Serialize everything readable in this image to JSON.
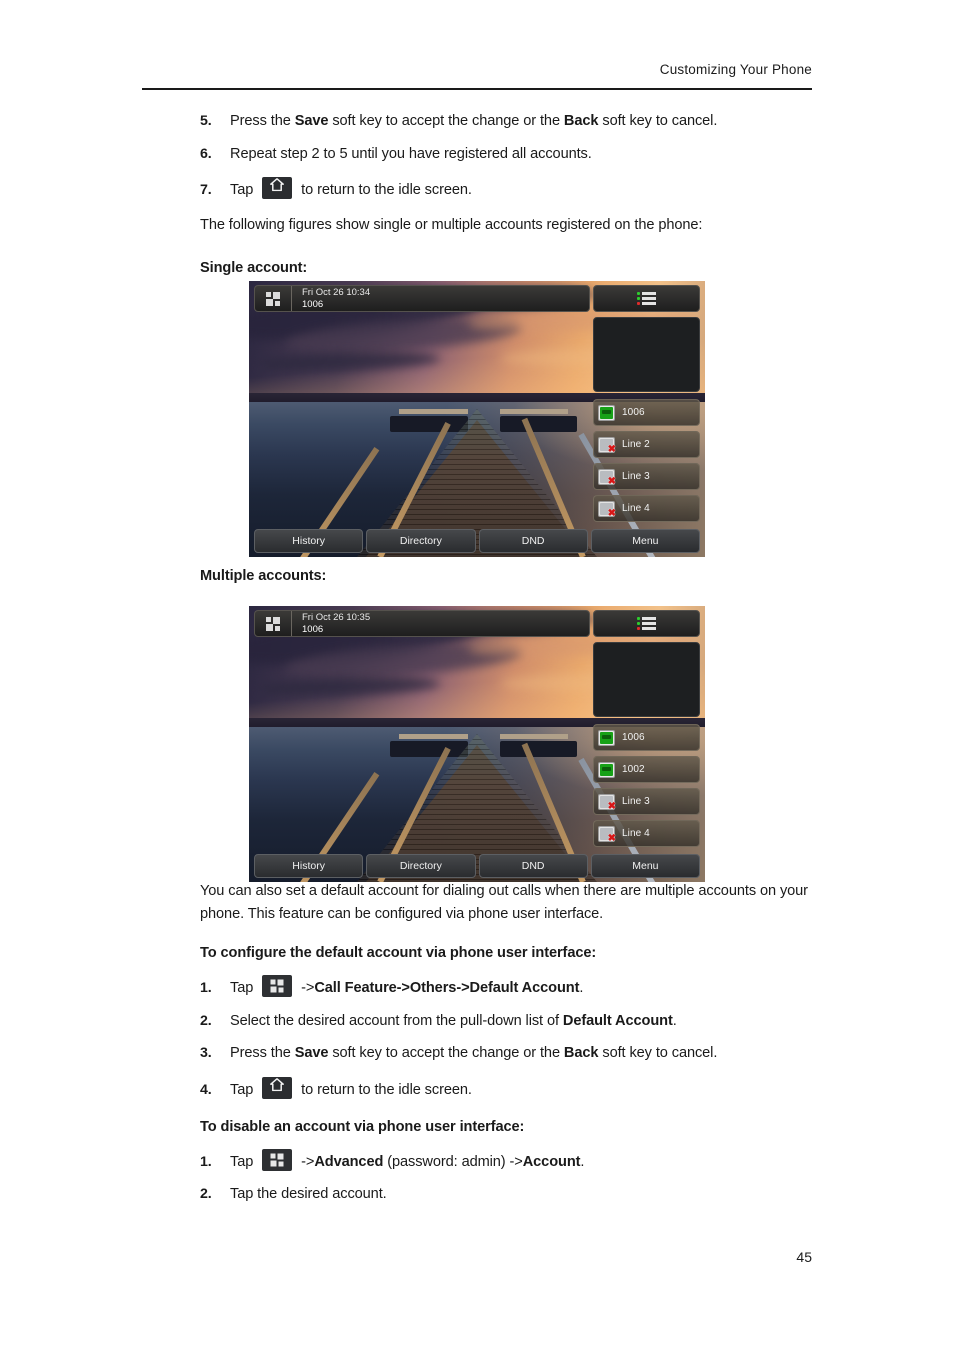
{
  "header": {
    "running_title": "Customizing Your Phone"
  },
  "page_number": "45",
  "steps_top": [
    {
      "num": "5.",
      "parts": [
        {
          "t": "Press the ",
          "b": false
        },
        {
          "t": "Save",
          "b": true
        },
        {
          "t": " soft key to accept the change or the ",
          "b": false
        },
        {
          "t": "Back",
          "b": true
        },
        {
          "t": " soft key to cancel.",
          "b": false
        }
      ]
    },
    {
      "num": "6.",
      "parts": [
        {
          "t": "Repeat step 2 to 5 until you have registered all accounts.",
          "b": false
        }
      ]
    },
    {
      "num": "7.",
      "parts": [
        {
          "t": "Tap ",
          "b": false
        },
        {
          "icon": "home-key-icon"
        },
        {
          "t": " to return to the idle screen.",
          "b": false
        }
      ]
    }
  ],
  "intro_paragraph": "The following figures show single or multiple accounts registered on the phone:",
  "figure_single_caption": "Single account:",
  "figure_multiple_caption": "Multiple accounts:",
  "phone_single": {
    "status_time": "Fri Oct 26 10:34",
    "status_account": "1006",
    "menu_icon": "line-status-list-icon",
    "lines": [
      {
        "label": "1006",
        "state": "registered"
      },
      {
        "label": "Line 2",
        "state": "unregistered"
      },
      {
        "label": "Line 3",
        "state": "unregistered"
      },
      {
        "label": "Line 4",
        "state": "unregistered"
      }
    ],
    "softkeys": [
      "History",
      "Directory",
      "DND",
      "Menu"
    ]
  },
  "phone_multiple": {
    "status_time": "Fri Oct 26 10:35",
    "status_account": "1006",
    "menu_icon": "line-status-list-icon",
    "lines": [
      {
        "label": "1006",
        "state": "registered"
      },
      {
        "label": "1002",
        "state": "registered"
      },
      {
        "label": "Line 3",
        "state": "unregistered"
      },
      {
        "label": "Line 4",
        "state": "unregistered"
      }
    ],
    "softkeys": [
      "History",
      "Directory",
      "DND",
      "Menu"
    ]
  },
  "body_paragraph": "You can also set a default account for dialing out calls when there are multiple accounts on your phone. This feature can be configured via phone user interface.",
  "section_default_account": {
    "heading": "To configure the default account via phone user interface:",
    "steps": [
      {
        "num": "1.",
        "parts": [
          {
            "t": "Tap ",
            "b": false
          },
          {
            "icon": "menu-grid-key-icon"
          },
          {
            "t": " ->",
            "b": false
          },
          {
            "t": "Call Feature",
            "b": true
          },
          {
            "t": "->",
            "b": true
          },
          {
            "t": "Others",
            "b": true
          },
          {
            "t": "->",
            "b": true
          },
          {
            "t": "Default Account",
            "b": true
          },
          {
            "t": ".",
            "b": false
          }
        ]
      },
      {
        "num": "2.",
        "parts": [
          {
            "t": "Select the desired account from the pull-down list of ",
            "b": false
          },
          {
            "t": "Default Account",
            "b": true
          },
          {
            "t": ".",
            "b": false
          }
        ]
      },
      {
        "num": "3.",
        "parts": [
          {
            "t": "Press the ",
            "b": false
          },
          {
            "t": "Save",
            "b": true
          },
          {
            "t": " soft key to accept the change or the ",
            "b": false
          },
          {
            "t": "Back",
            "b": true
          },
          {
            "t": " soft key to cancel.",
            "b": false
          }
        ]
      },
      {
        "num": "4.",
        "parts": [
          {
            "t": "Tap ",
            "b": false
          },
          {
            "icon": "home-key-icon"
          },
          {
            "t": " to return to the idle screen.",
            "b": false
          }
        ]
      }
    ]
  },
  "section_disable_account": {
    "heading": "To disable an account via phone user interface:",
    "steps": [
      {
        "num": "1.",
        "parts": [
          {
            "t": "Tap ",
            "b": false
          },
          {
            "icon": "menu-grid-key-icon"
          },
          {
            "t": " ->",
            "b": false
          },
          {
            "t": "Advanced",
            "b": true
          },
          {
            "t": " (password: admin) ->",
            "b": false
          },
          {
            "t": "Account",
            "b": true
          },
          {
            "t": ".",
            "b": false
          }
        ]
      },
      {
        "num": "2.",
        "parts": [
          {
            "t": "Tap the desired account.",
            "b": false
          }
        ]
      }
    ]
  },
  "colors": {
    "registered_green": "#17a117",
    "unregistered_red": "#d81717",
    "text": "#1a1a1a"
  }
}
